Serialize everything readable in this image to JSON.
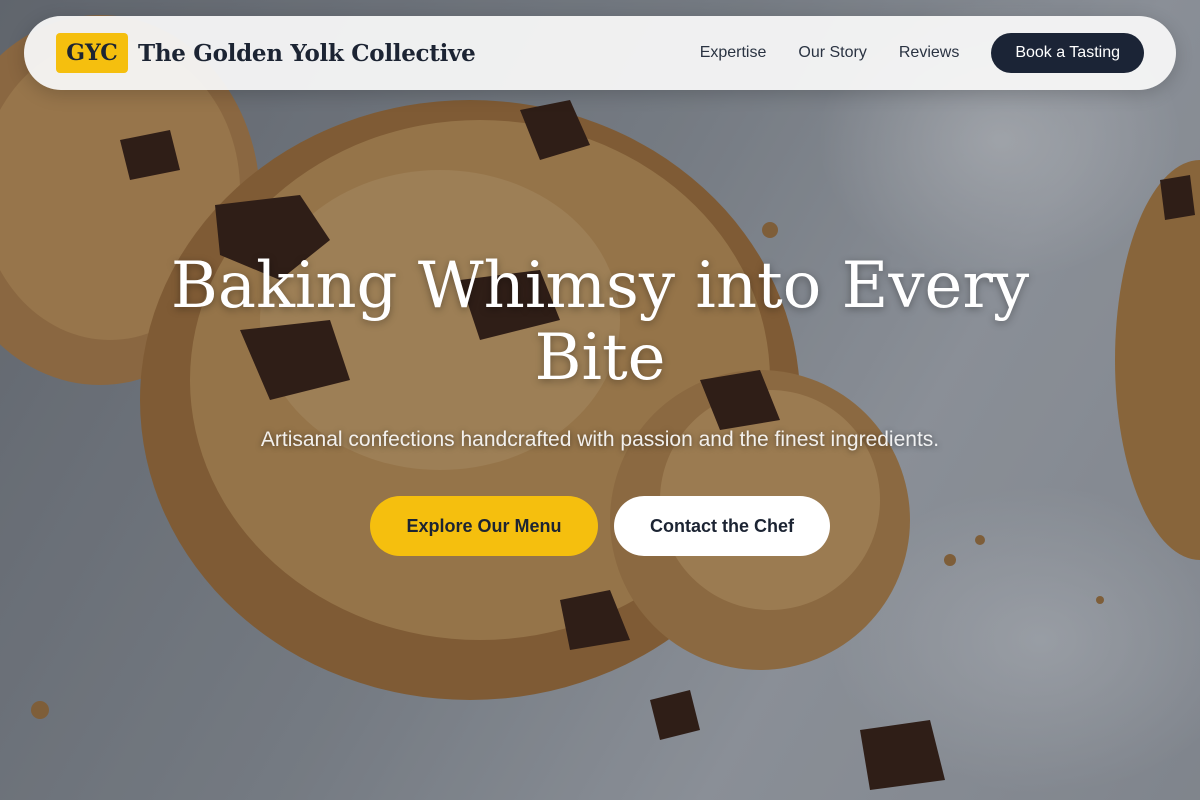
{
  "nav": {
    "logo_text": "GYC",
    "brand_name": "The Golden Yolk Collective",
    "links": [
      "Expertise",
      "Our Story",
      "Reviews"
    ],
    "cta": "Book a Tasting"
  },
  "hero": {
    "title": "Baking Whimsy into Every Bite",
    "subtitle": "Artisanal confections handcrafted with passion and the finest ingredients.",
    "primary_button": "Explore Our Menu",
    "secondary_button": "Contact the Chef"
  },
  "colors": {
    "accent": "#f5bf0e",
    "dark": "#1b2436",
    "text": "#1c2433"
  },
  "images": {
    "background": "chocolate-chip-cookies-photo"
  }
}
